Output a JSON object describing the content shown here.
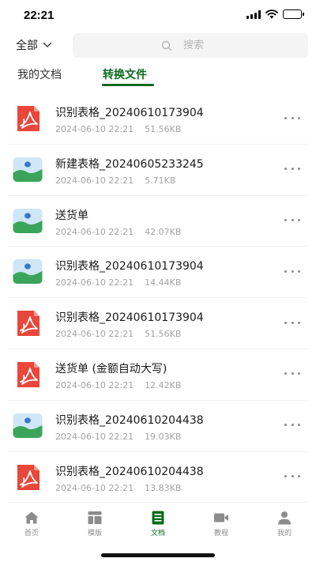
{
  "status": {
    "time": "22:21"
  },
  "filter": {
    "label": "全部"
  },
  "search": {
    "placeholder": "搜索"
  },
  "tabs": [
    {
      "label": "我的文档",
      "active": false
    },
    {
      "label": "转换文件",
      "active": true
    }
  ],
  "files": [
    {
      "name": "识别表格_20240610173904",
      "date": "2024-06-10 22:21",
      "size": "51.56KB",
      "icon": "pdf-icon"
    },
    {
      "name": "新建表格_20240605233245",
      "date": "2024-06-10 22:21",
      "size": "5.71KB",
      "icon": "image-icon"
    },
    {
      "name": "送货单",
      "date": "2024-06-10 22:21",
      "size": "42.07KB",
      "icon": "image-icon"
    },
    {
      "name": "识别表格_20240610173904",
      "date": "2024-06-10 22:21",
      "size": "14.44KB",
      "icon": "image-icon"
    },
    {
      "name": "识别表格_20240610173904",
      "date": "2024-06-10 22:21",
      "size": "51.56KB",
      "icon": "pdf-icon"
    },
    {
      "name": "送货单 (金额自动大写)",
      "date": "2024-06-10 22:21",
      "size": "12.42KB",
      "icon": "pdf-icon"
    },
    {
      "name": "识别表格_20240610204438",
      "date": "2024-06-10 22:21",
      "size": "19.03KB",
      "icon": "image-icon"
    },
    {
      "name": "识别表格_20240610204438",
      "date": "2024-06-10 22:21",
      "size": "13.83KB",
      "icon": "pdf-icon"
    }
  ],
  "nav": [
    {
      "label": "首页",
      "icon": "home-icon",
      "active": false
    },
    {
      "label": "模版",
      "icon": "template-icon",
      "active": false
    },
    {
      "label": "文档",
      "icon": "document-icon",
      "active": true
    },
    {
      "label": "教程",
      "icon": "video-icon",
      "active": false
    },
    {
      "label": "我的",
      "icon": "profile-icon",
      "active": false
    }
  ],
  "colors": {
    "accent": "#0b6b1e",
    "pdf_red": "#e8473a",
    "image_blue": "#cfe6f7",
    "image_green": "#3aa55a"
  }
}
